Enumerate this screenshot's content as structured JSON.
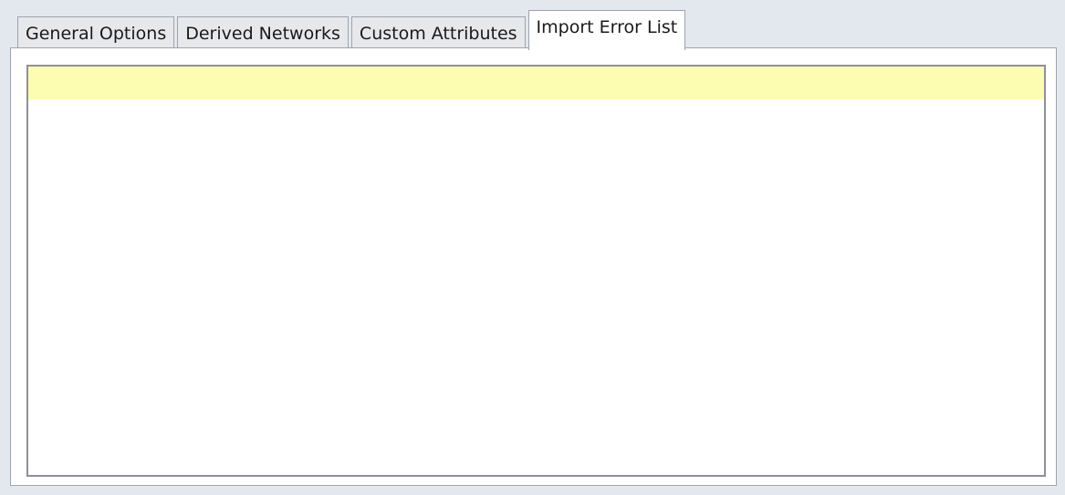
{
  "tabs": [
    {
      "label": "General Options",
      "active": false
    },
    {
      "label": "Derived Networks",
      "active": false
    },
    {
      "label": "Custom Attributes",
      "active": false
    },
    {
      "label": "Import Error List",
      "active": true
    }
  ],
  "error_list": {
    "rows": [
      ""
    ],
    "highlight_color": "#fdfdb2"
  }
}
